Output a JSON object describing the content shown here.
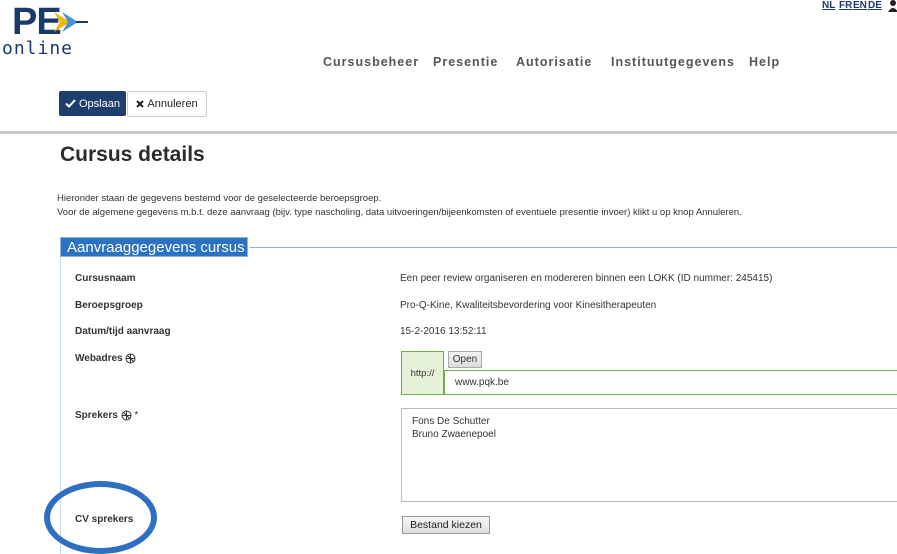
{
  "logo": {
    "brand": "PE",
    "sub": "online"
  },
  "languages": [
    "NL",
    "FR",
    "EN",
    "DE"
  ],
  "nav": [
    "Cursusbeheer",
    "Presentie",
    "Autorisatie",
    "Instituutgegevens",
    "Help"
  ],
  "toolbar": {
    "save_label": "Opslaan",
    "cancel_label": "Annuleren"
  },
  "page": {
    "title": "Cursus details",
    "intro_line1": "Hieronder staan de gegevens bestemd voor de geselecteerde beroepsgroep.",
    "intro_line2": "Voor de algemene gegevens m.b.t. deze aanvraag (bijv. type nascholing, data uitvoeringen/bijeenkomsten of eventuele presentie invoer) klikt u op knop Annuleren."
  },
  "section": {
    "title": "Aanvraaggegevens cursus",
    "fields": {
      "course_name_label": "Cursusnaam",
      "course_name_value": "Een peer review organiseren en modereren binnen een LOKK (ID nummer: 245415)",
      "profession_label": "Beroepsgroep",
      "profession_value": "Pro-Q-Kine, Kwaliteitsbevordering voor Kinesitherapeuten",
      "date_label": "Datum/tijd aanvraag",
      "date_value": "15-2-2016 13:52:11",
      "web_label": "Webadres",
      "web_prefix": "http://",
      "web_open": "Open",
      "web_value": "www.pqk.be",
      "speakers_label": "Sprekers",
      "speakers_required": "*",
      "speakers_values": [
        "Fons De Schutter",
        "Bruno Zwaenepoel"
      ],
      "cv_label": "CV sprekers",
      "file_button": "Bestand kiezen"
    }
  },
  "colors": {
    "brand_navy": "#1e3e6e",
    "section_blue": "#2c72c2",
    "url_green": "#6ab04c",
    "highlight_circle": "#2e6fc2"
  },
  "icons": {
    "save": "check-icon",
    "cancel": "x-icon",
    "translate": "translate-icon",
    "user": "user-icon"
  }
}
